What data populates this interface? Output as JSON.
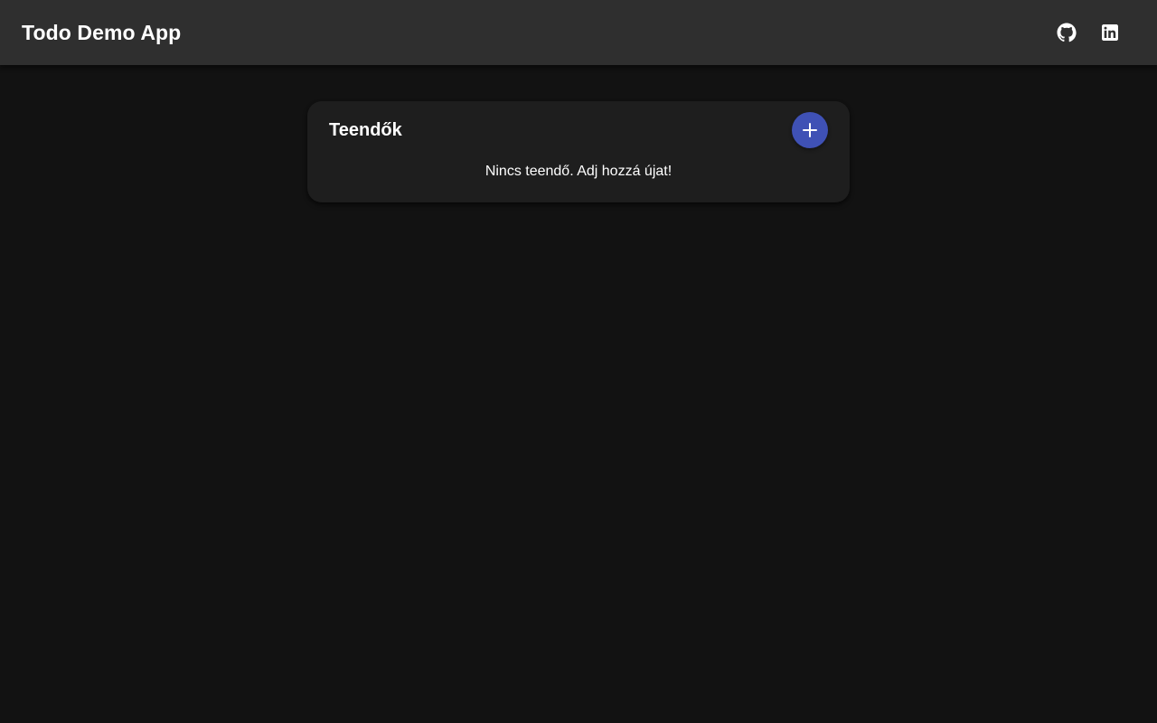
{
  "app_bar": {
    "title": "Todo Demo App",
    "actions": [
      {
        "icon": "github-icon"
      },
      {
        "icon": "linkedin-icon"
      }
    ]
  },
  "todo_card": {
    "title": "Teendők",
    "add_button_icon": "plus-icon",
    "empty_message": "Nincs teendő. Adj hozzá újat!"
  },
  "colors": {
    "background": "#121212",
    "app_bar": "#2f2f2f",
    "card": "#1e1e1e",
    "accent": "#3f51b5",
    "text": "#ffffff"
  }
}
